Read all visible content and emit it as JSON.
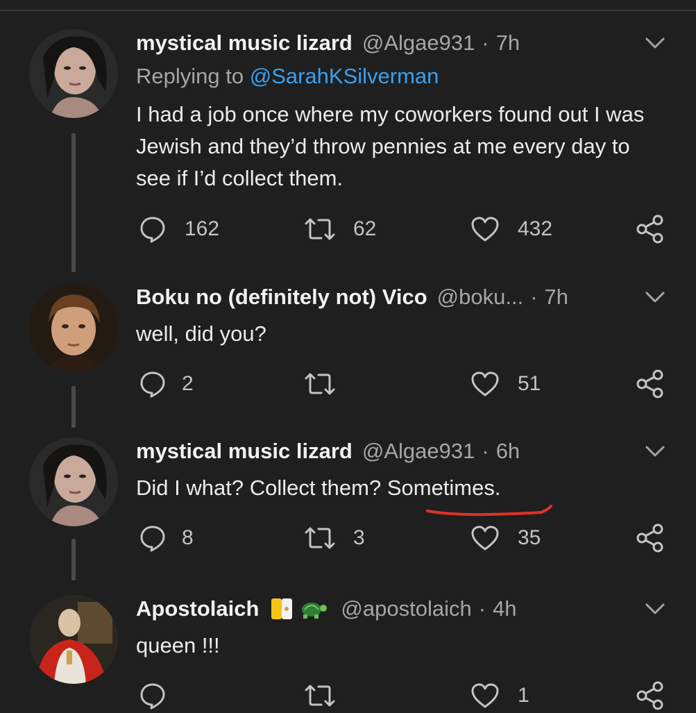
{
  "tweets": [
    {
      "name": "mystical music lizard",
      "handle": "@Algae931",
      "time": "7h",
      "replying_prefix": "Replying to",
      "replying_to": "@SarahKSilverman",
      "text": "I had a job once where my coworkers found out I was Jewish and they’d throw pennies at me every day to see if I’d collect them.",
      "replies": "162",
      "retweets": "62",
      "likes": "432"
    },
    {
      "name": "Boku no (definitely not) Vico",
      "handle": "@boku...",
      "time": "7h",
      "text": "well, did you?",
      "replies": "2",
      "retweets": "",
      "likes": "51"
    },
    {
      "name": "mystical music lizard",
      "handle": "@Algae931",
      "time": "6h",
      "text": "Did I what? Collect them? Sometimes.",
      "replies": "8",
      "retweets": "3",
      "likes": "35"
    },
    {
      "name": "Apostolaich",
      "handle": "@apostolaich",
      "time": "4h",
      "text": "queen !!!",
      "replies": "",
      "retweets": "",
      "likes": "1"
    }
  ],
  "icons": {
    "reply": "reply-icon",
    "retweet": "retweet-icon",
    "like": "heart-icon",
    "share": "share-icon",
    "more": "chevron-down-icon"
  },
  "colors": {
    "background": "#1f1f1f",
    "link": "#3aa0f0",
    "annotation": "#e0322a"
  }
}
